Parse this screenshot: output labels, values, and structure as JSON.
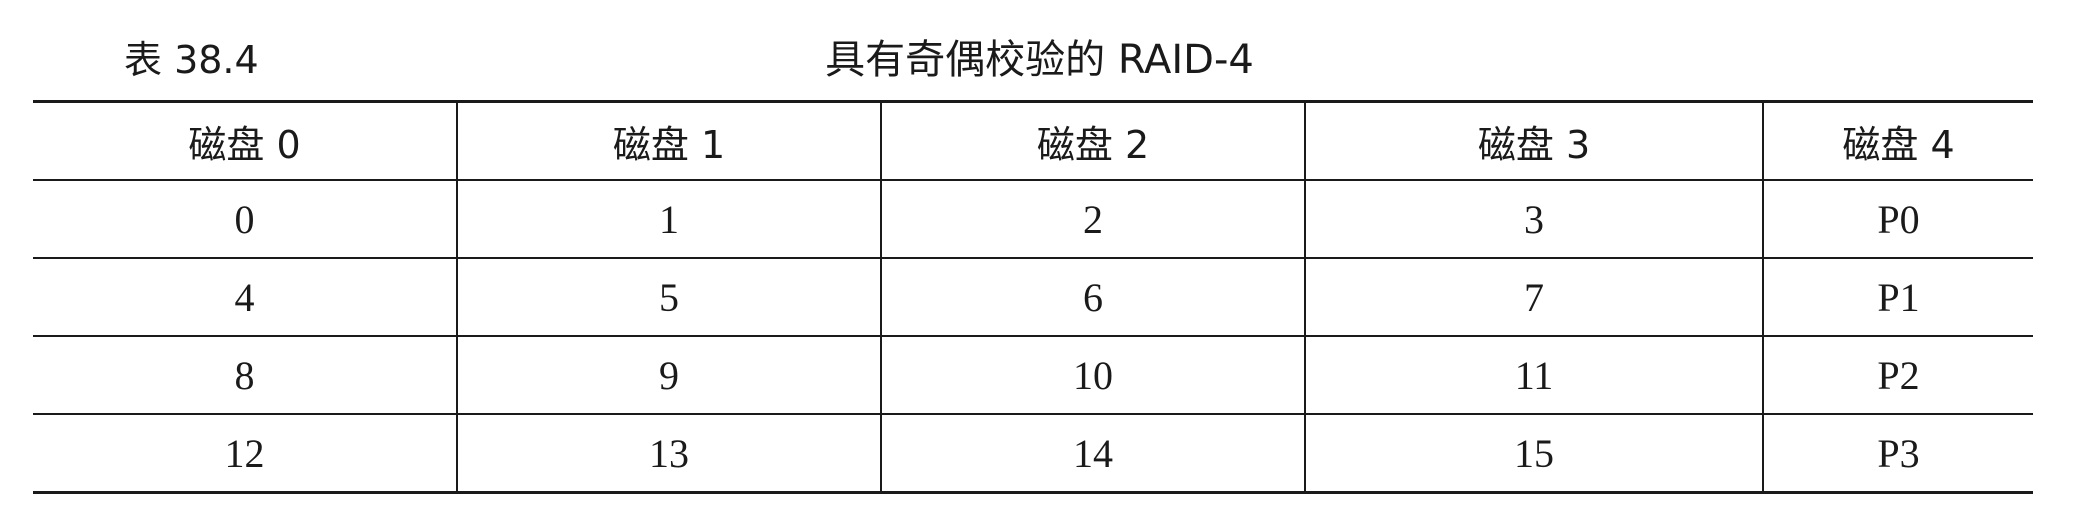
{
  "caption": {
    "label": "表 38.4",
    "title": "具有奇偶校验的 RAID-4"
  },
  "table": {
    "headers": [
      "磁盘 0",
      "磁盘 1",
      "磁盘 2",
      "磁盘 3",
      "磁盘 4"
    ],
    "rows": [
      [
        "0",
        "1",
        "2",
        "3",
        "P0"
      ],
      [
        "4",
        "5",
        "6",
        "7",
        "P1"
      ],
      [
        "8",
        "9",
        "10",
        "11",
        "P2"
      ],
      [
        "12",
        "13",
        "14",
        "15",
        "P3"
      ]
    ]
  }
}
